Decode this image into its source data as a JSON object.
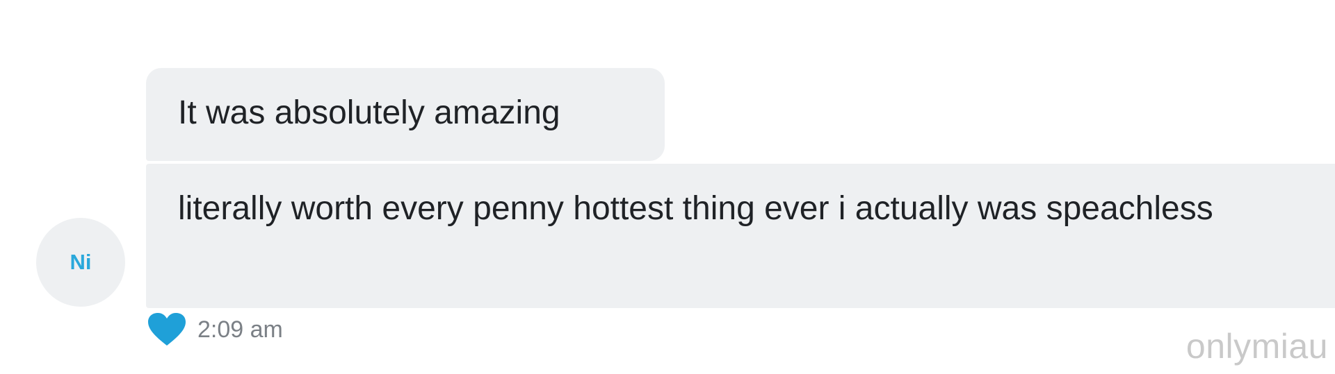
{
  "conversation": {
    "avatar_initials": "Ni",
    "messages": [
      {
        "text": "It was absolutely amazing"
      },
      {
        "text": "literally worth every penny hottest thing ever i actually was speachless"
      }
    ],
    "reaction_icon": "heart-icon",
    "timestamp": "2:09 am"
  },
  "watermark": "onlymiau",
  "colors": {
    "bubble": "#eef0f2",
    "avatar_text": "#2aa8db",
    "heart": "#1fa0d8",
    "timestamp": "#7b8086",
    "watermark": "#c9c9c9"
  }
}
